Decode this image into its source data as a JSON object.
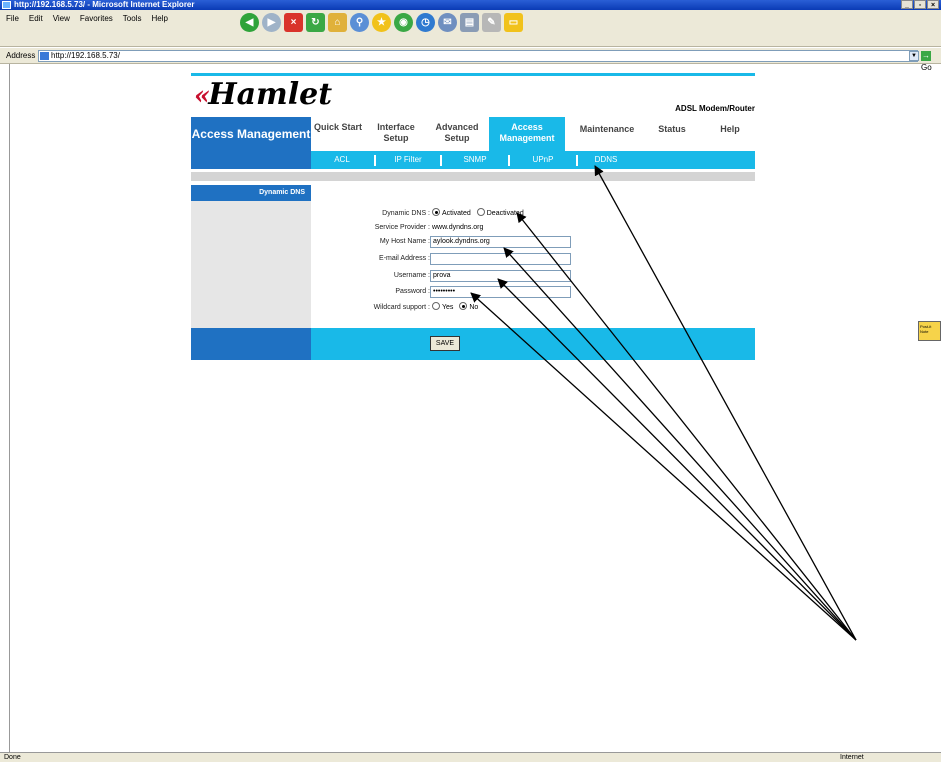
{
  "browser": {
    "title": "http://192.168.5.73/ - Microsoft Internet Explorer",
    "menu": [
      "File",
      "Edit",
      "View",
      "Favorites",
      "Tools",
      "Help"
    ],
    "address_label": "Address",
    "url": "http://192.168.5.73/",
    "go_label": "Go",
    "status": "Done",
    "zone": "Internet",
    "sticky_note": "Post-it Note"
  },
  "router": {
    "brand": "Hamlet",
    "product": "ADSL Modem/Router",
    "section_title": "Access Management",
    "nav": [
      {
        "label": "Quick Start"
      },
      {
        "label": "Interface Setup"
      },
      {
        "label": "Advanced Setup"
      },
      {
        "label": "Access Management",
        "active": true
      },
      {
        "label": "Maintenance"
      },
      {
        "label": "Status"
      },
      {
        "label": "Help"
      }
    ],
    "subnav": [
      "ACL",
      "IP Filter",
      "SNMP",
      "UPnP",
      "DDNS"
    ],
    "sidebar_title": "Dynamic DNS",
    "form": {
      "dynamic_dns_label": "Dynamic DNS :",
      "option_activated": "Activated",
      "option_deactivated": "Deactivated",
      "dynamic_dns_value": "Activated",
      "service_provider_label": "Service Provider :",
      "service_provider_value": "www.dyndns.org",
      "host_name_label": "My Host Name :",
      "host_name_value": "aylook.dyndns.org",
      "email_label": "E-mail Address :",
      "email_value": "",
      "username_label": "Username :",
      "username_value": "prova",
      "password_label": "Password :",
      "password_value": "•••••••••",
      "wildcard_label": "Wildcard support :",
      "option_yes": "Yes",
      "option_no": "No",
      "wildcard_value": "No"
    },
    "save_label": "SAVE"
  },
  "accent_colors": {
    "cyan": "#19b9e8",
    "blue": "#1f71c2",
    "logo_red": "#c8102e"
  }
}
